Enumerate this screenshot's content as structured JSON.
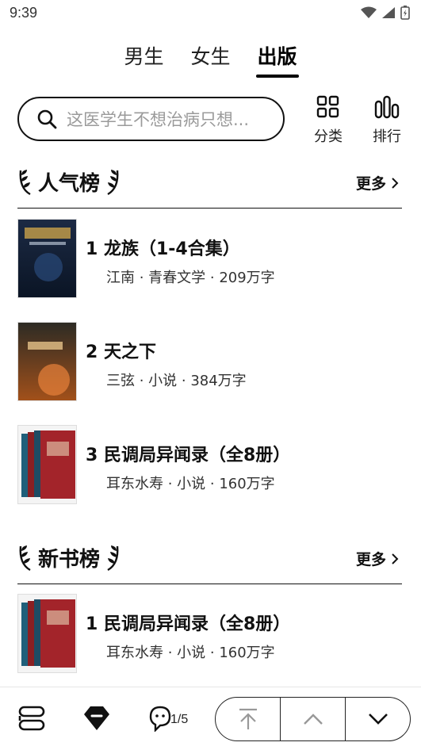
{
  "status_bar": {
    "time": "9:39"
  },
  "tabs": [
    {
      "label": "男生",
      "active": false
    },
    {
      "label": "女生",
      "active": false
    },
    {
      "label": "出版",
      "active": true
    }
  ],
  "search": {
    "placeholder": "这医学生不想治病只想..."
  },
  "tools": {
    "category": {
      "label": "分类",
      "icon": "grid-icon"
    },
    "ranking": {
      "label": "排行",
      "icon": "bars-icon"
    }
  },
  "sections": [
    {
      "title": "人气榜",
      "more_label": "更多",
      "books": [
        {
          "rank": "1",
          "title": "龙族（1-4合集）",
          "meta": "江南 · 青春文学 · 209万字"
        },
        {
          "rank": "2",
          "title": "天之下",
          "meta": "三弦 · 小说 · 384万字"
        },
        {
          "rank": "3",
          "title": "民调局异闻录（全8册）",
          "meta": "耳东水寿 · 小说 · 160万字"
        }
      ]
    },
    {
      "title": "新书榜",
      "more_label": "更多",
      "books": [
        {
          "rank": "1",
          "title": "民调局异闻录（全8册）",
          "meta": "耳东水寿 · 小说 · 160万字"
        }
      ]
    }
  ],
  "bottom_bar": {
    "page_indicator": "1/5",
    "icons": [
      "stack-icon",
      "gem-icon",
      "feedback-face-icon",
      "scroll-top-icon",
      "prev-icon",
      "next-icon"
    ]
  },
  "colors": {
    "text": "#111111",
    "placeholder": "#9a9a9a",
    "divider": "#111111"
  }
}
